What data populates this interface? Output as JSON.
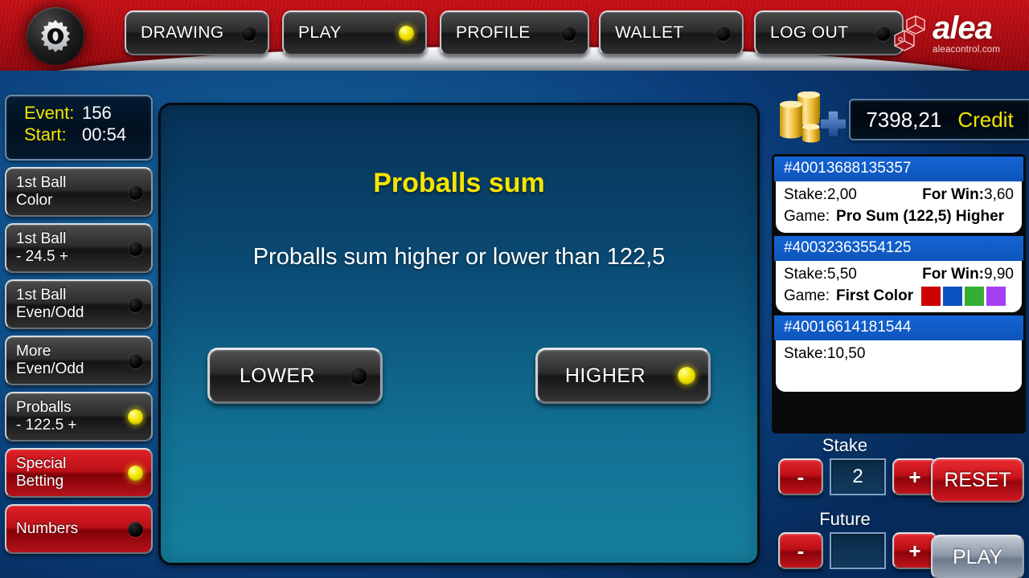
{
  "header": {
    "gear_icon": "gear-icon",
    "nav_buttons": [
      {
        "label": "DRAWING",
        "led": "off"
      },
      {
        "label": "PLAY",
        "led": "on"
      },
      {
        "label": "PROFILE",
        "led": "off"
      },
      {
        "label": "WALLET",
        "led": "off"
      },
      {
        "label": "LOG OUT",
        "led": "off"
      }
    ],
    "logo": {
      "name": "alea",
      "name_part1": "al",
      "name_part2": "e",
      "name_part3": "a",
      "tagline": "aleacontrol.com"
    }
  },
  "sidebar": {
    "event": {
      "event_label": "Event:",
      "event_value": "156",
      "start_label": "Start:",
      "start_value": "00:54"
    },
    "items": [
      {
        "line1": "1st Ball",
        "line2": "Color",
        "style": "dark",
        "led": "off"
      },
      {
        "line1": "1st Ball",
        "line2": "- 24.5 +",
        "style": "dark",
        "led": "off"
      },
      {
        "line1": "1st Ball",
        "line2": "Even/Odd",
        "style": "dark",
        "led": "off"
      },
      {
        "line1": "More",
        "line2": "Even/Odd",
        "style": "dark",
        "led": "off"
      },
      {
        "line1": "Proballs",
        "line2": "- 122.5 +",
        "style": "dark",
        "led": "on"
      },
      {
        "line1": "Special",
        "line2": "Betting",
        "style": "red",
        "led": "on"
      },
      {
        "line1": "Numbers",
        "line2": "",
        "style": "red",
        "led": "off"
      }
    ]
  },
  "main": {
    "title": "Proballs sum",
    "subtitle": "Proballs sum higher or lower than 122,5",
    "choices": [
      {
        "label": "LOWER",
        "led": "off"
      },
      {
        "label": "HIGHER",
        "led": "on"
      }
    ]
  },
  "right": {
    "coins_icon": "coins-plus-icon",
    "credit": {
      "amount": "7398,21",
      "label": "Credit"
    },
    "slips": [
      {
        "id": "#40013688135357",
        "stake_label": "Stake:",
        "stake_value": "2,00",
        "win_label": "For Win:",
        "win_value": "3,60",
        "game_label": "Game:",
        "game_value": "Pro Sum (122,5) Higher",
        "swatches": []
      },
      {
        "id": "#40032363554125",
        "stake_label": "Stake:",
        "stake_value": "5,50",
        "win_label": "For Win:",
        "win_value": "9,90",
        "game_label": "Game:",
        "game_value": "First Color",
        "swatches": [
          "#cc0000",
          "#0b52c0",
          "#33b033",
          "#a43ff5"
        ]
      },
      {
        "id": "#40016614181544",
        "stake_label": "Stake:",
        "stake_value": "10,50",
        "win_label": "",
        "win_value": "",
        "game_label": "",
        "game_value": "",
        "swatches": []
      }
    ],
    "stake": {
      "title": "Stake",
      "minus": "-",
      "plus": "+",
      "value": "2"
    },
    "future": {
      "title": "Future",
      "minus": "-",
      "plus": "+",
      "value": ""
    },
    "reset_label": "RESET",
    "play_label": "PLAY"
  }
}
